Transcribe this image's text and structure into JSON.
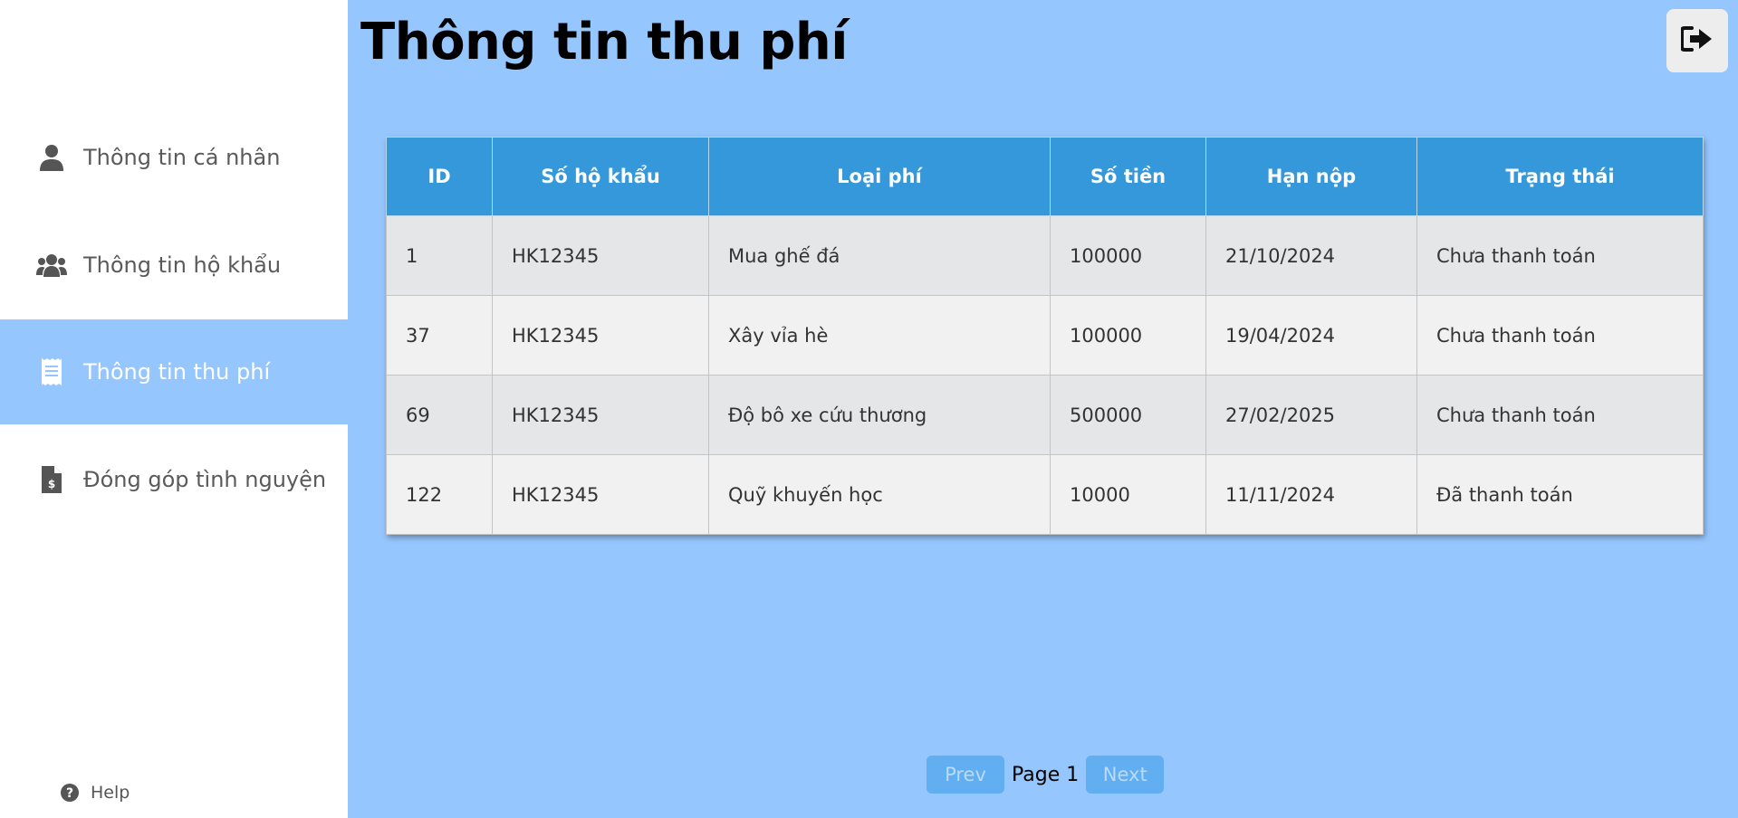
{
  "page": {
    "title": "Thông tin thu phí"
  },
  "sidebar": {
    "items": [
      {
        "label": "Thông tin cá nhân",
        "icon": "user-icon"
      },
      {
        "label": "Thông tin hộ khẩu",
        "icon": "users-icon"
      },
      {
        "label": "Thông tin thu phí",
        "icon": "receipt-icon",
        "active": true
      },
      {
        "label": "Đóng góp tình nguyện",
        "icon": "invoice-dollar-icon"
      }
    ],
    "help": {
      "label": "Help",
      "icon": "question-circle-icon"
    }
  },
  "header": {
    "logout_icon": "sign-out-icon"
  },
  "table": {
    "headers": [
      "ID",
      "Số hộ khẩu",
      "Loại phí",
      "Số tiền",
      "Hạn nộp",
      "Trạng thái"
    ],
    "rows": [
      [
        "1",
        "HK12345",
        "Mua ghế đá",
        "100000",
        "21/10/2024",
        "Chưa thanh toán"
      ],
      [
        "37",
        "HK12345",
        "Xây vỉa hè",
        "100000",
        "19/04/2024",
        "Chưa thanh toán"
      ],
      [
        "69",
        "HK12345",
        "Độ bô xe cứu thương",
        "500000",
        "27/02/2025",
        "Chưa thanh toán"
      ],
      [
        "122",
        "HK12345",
        "Quỹ khuyến học",
        "10000",
        "11/11/2024",
        "Đã thanh toán"
      ]
    ]
  },
  "pagination": {
    "prev_label": "Prev",
    "page_label": "Page 1",
    "next_label": "Next"
  },
  "colors": {
    "background": "#95c6fd",
    "header_blue": "#3498db",
    "button_blue": "#61aef0",
    "sidebar": "#ffffff"
  }
}
